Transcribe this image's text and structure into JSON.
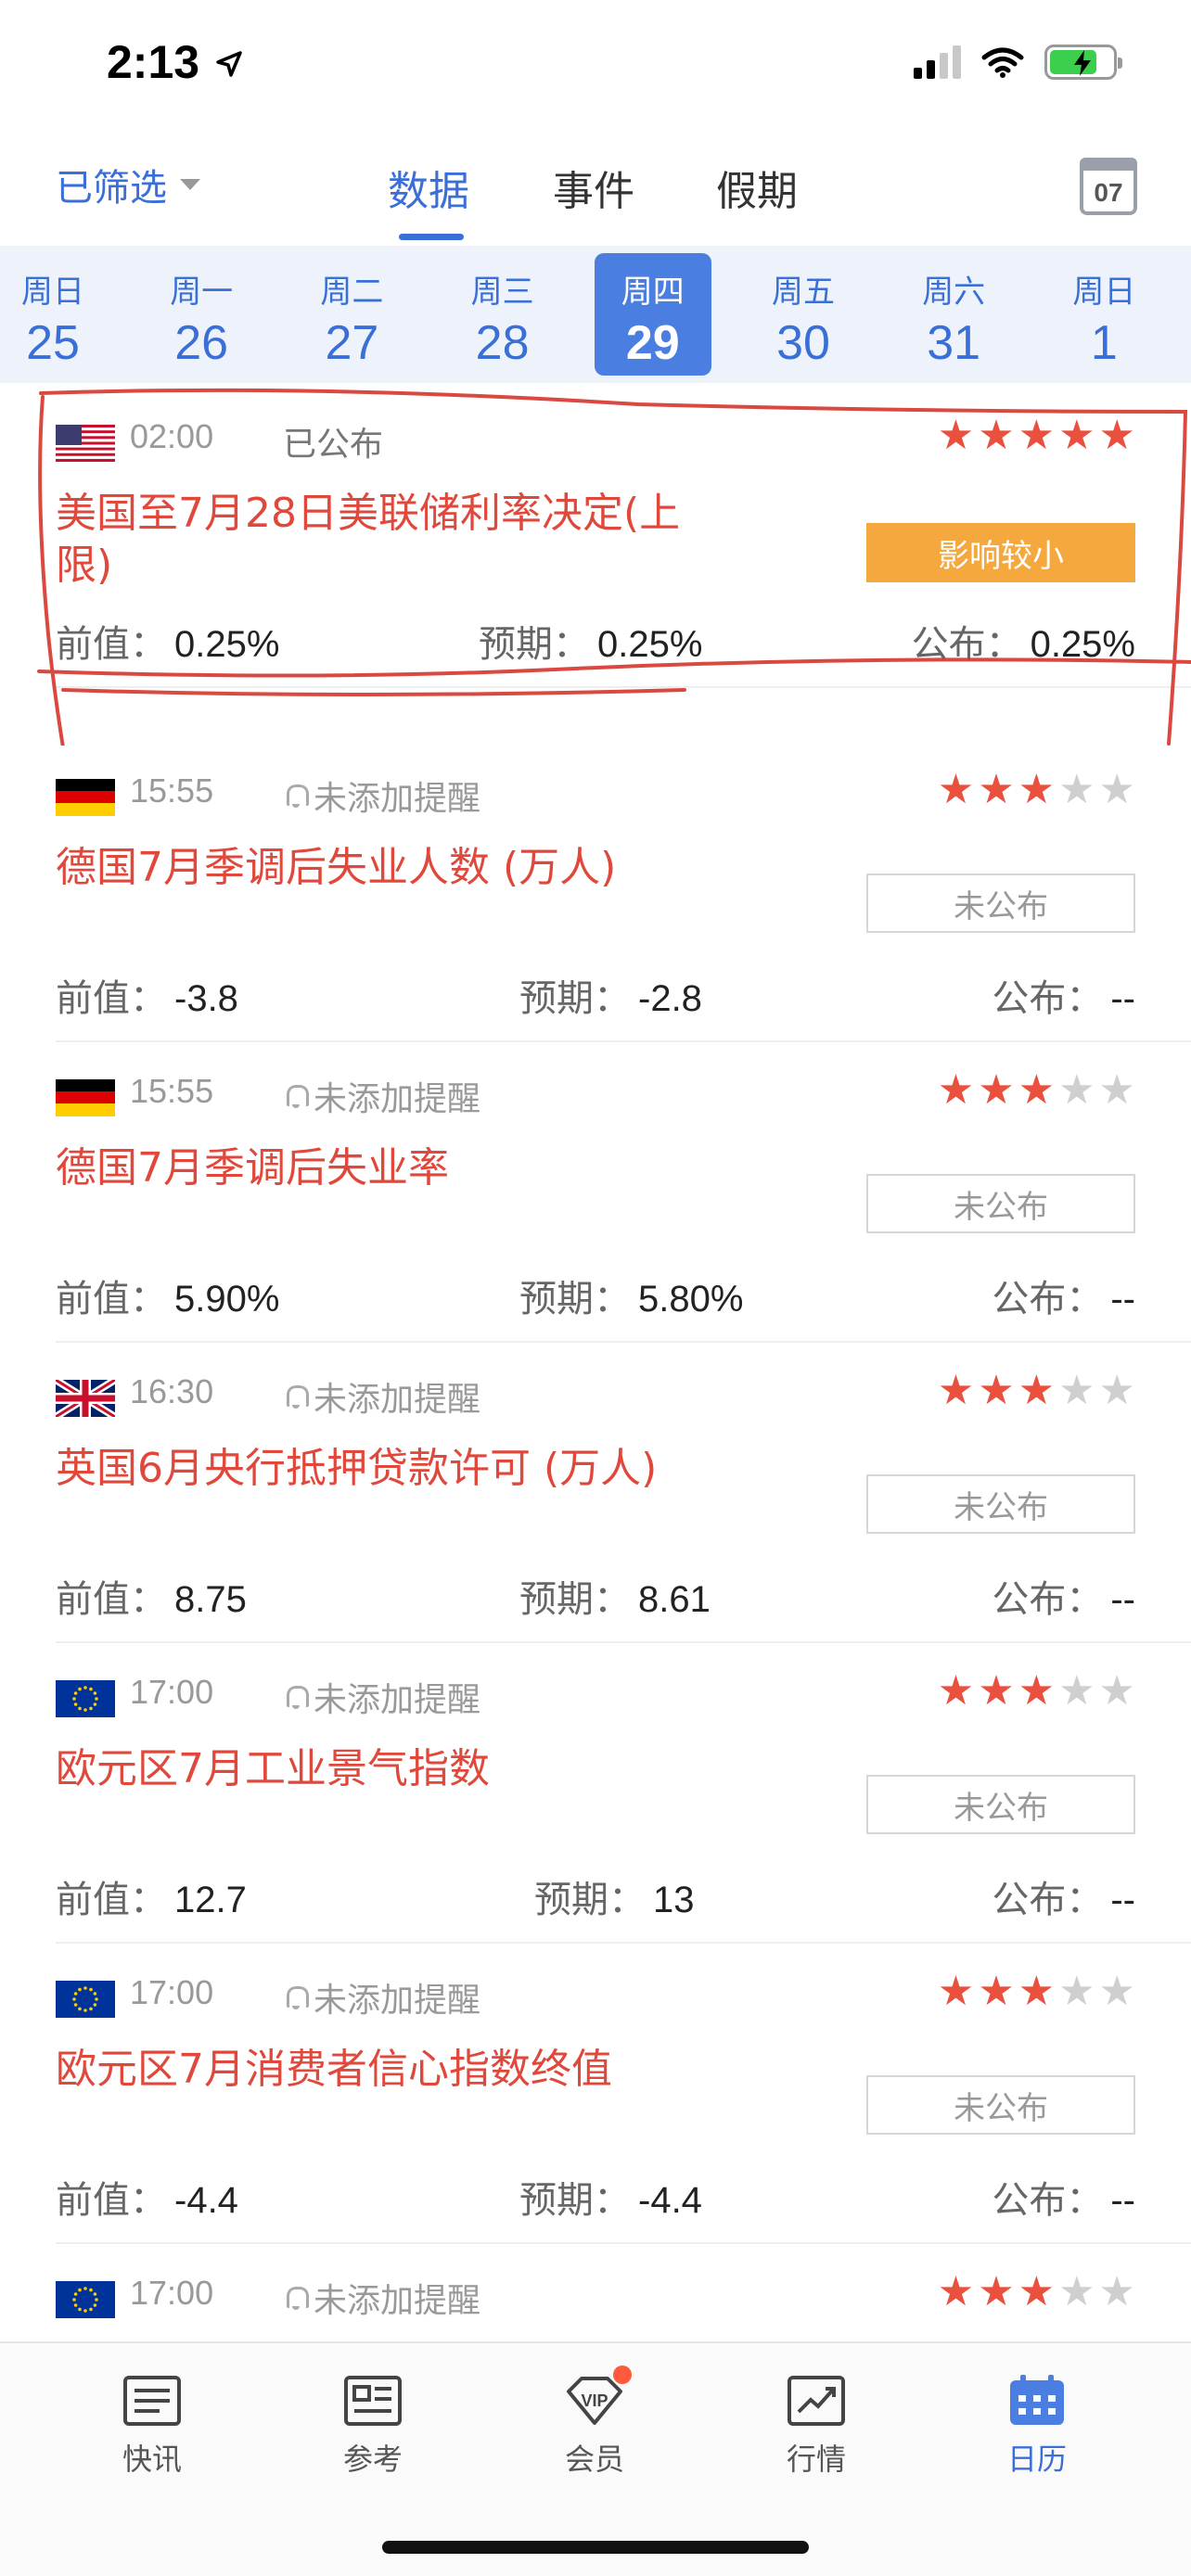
{
  "status_bar": {
    "time": "2:13"
  },
  "header": {
    "filter_label": "已筛选",
    "tabs": [
      "数据",
      "事件",
      "假期"
    ],
    "active_tab": "数据",
    "calendar_day": "07"
  },
  "days": [
    {
      "weekday": "周日",
      "date": "25"
    },
    {
      "weekday": "周一",
      "date": "26"
    },
    {
      "weekday": "周二",
      "date": "27"
    },
    {
      "weekday": "周三",
      "date": "28"
    },
    {
      "weekday": "周四",
      "date": "29"
    },
    {
      "weekday": "周五",
      "date": "30"
    },
    {
      "weekday": "周六",
      "date": "31"
    },
    {
      "weekday": "周日",
      "date": "1"
    }
  ],
  "active_day": "29",
  "labels": {
    "prev": "前值：",
    "forecast": "预期：",
    "actual": "公布："
  },
  "events": [
    {
      "flag": "us",
      "time": "02:00",
      "status": "已公布",
      "stars": 5,
      "title": "美国至7月28日美联储利率决定(上限)",
      "badge": "影响较小",
      "badge_type": "impact",
      "prev": "0.25%",
      "forecast": "0.25%",
      "actual": "0.25%"
    },
    {
      "flag": "de",
      "time": "15:55",
      "status": "未添加提醒",
      "stars": 3,
      "title": "德国7月季调后失业人数 (万人)",
      "badge": "未公布",
      "badge_type": "pending",
      "prev": "-3.8",
      "forecast": "-2.8",
      "actual": "--"
    },
    {
      "flag": "de",
      "time": "15:55",
      "status": "未添加提醒",
      "stars": 3,
      "title": "德国7月季调后失业率",
      "badge": "未公布",
      "badge_type": "pending",
      "prev": "5.90%",
      "forecast": "5.80%",
      "actual": "--"
    },
    {
      "flag": "uk",
      "time": "16:30",
      "status": "未添加提醒",
      "stars": 3,
      "title": "英国6月央行抵押贷款许可 (万人)",
      "badge": "未公布",
      "badge_type": "pending",
      "prev": "8.75",
      "forecast": "8.61",
      "actual": "--"
    },
    {
      "flag": "eu",
      "time": "17:00",
      "status": "未添加提醒",
      "stars": 3,
      "title": "欧元区7月工业景气指数",
      "badge": "未公布",
      "badge_type": "pending",
      "prev": "12.7",
      "forecast": "13",
      "actual": "--"
    },
    {
      "flag": "eu",
      "time": "17:00",
      "status": "未添加提醒",
      "stars": 3,
      "title": "欧元区7月消费者信心指数终值",
      "badge": "未公布",
      "badge_type": "pending",
      "prev": "-4.4",
      "forecast": "-4.4",
      "actual": "--"
    },
    {
      "flag": "eu",
      "time": "17:00",
      "status": "未添加提醒",
      "stars": 3,
      "title": "",
      "badge": "",
      "badge_type": "none",
      "prev": "",
      "forecast": "",
      "actual": ""
    }
  ],
  "bottom_nav": [
    {
      "label": "快讯",
      "icon": "news-icon"
    },
    {
      "label": "参考",
      "icon": "reference-icon"
    },
    {
      "label": "会员",
      "icon": "vip-icon"
    },
    {
      "label": "行情",
      "icon": "chart-icon"
    },
    {
      "label": "日历",
      "icon": "calendar-icon"
    }
  ],
  "active_nav": "日历",
  "colors": {
    "accent": "#3a6fd8",
    "title_red": "#e0483c",
    "star_red": "#e9503e",
    "impact_orange": "#f4a83e"
  }
}
